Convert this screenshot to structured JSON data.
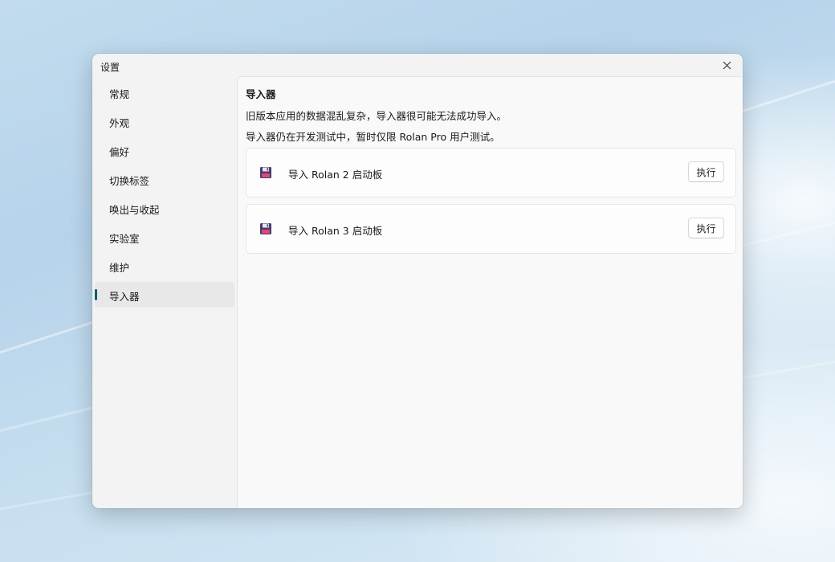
{
  "window": {
    "title": "设置"
  },
  "sidebar": {
    "items": [
      {
        "label": "常规"
      },
      {
        "label": "外观"
      },
      {
        "label": "偏好"
      },
      {
        "label": "切换标签"
      },
      {
        "label": "唤出与收起"
      },
      {
        "label": "实验室"
      },
      {
        "label": "维护"
      },
      {
        "label": "导入器",
        "active": true
      }
    ]
  },
  "main": {
    "title": "导入器",
    "descriptions": [
      "旧版本应用的数据混乱复杂，导入器很可能无法成功导入。",
      "导入器仍在开发测试中，暂时仅限 Rolan Pro 用户测试。"
    ],
    "cards": [
      {
        "icon": "floppy-disk-icon",
        "label": "导入 Rolan 2 启动板",
        "button": "执行"
      },
      {
        "icon": "floppy-disk-icon",
        "label": "导入 Rolan 3 启动板",
        "button": "执行"
      }
    ]
  },
  "colors": {
    "accent": "#0f5f6d",
    "floppy": "#4a3b6b",
    "floppy_label": "#e0457b"
  }
}
